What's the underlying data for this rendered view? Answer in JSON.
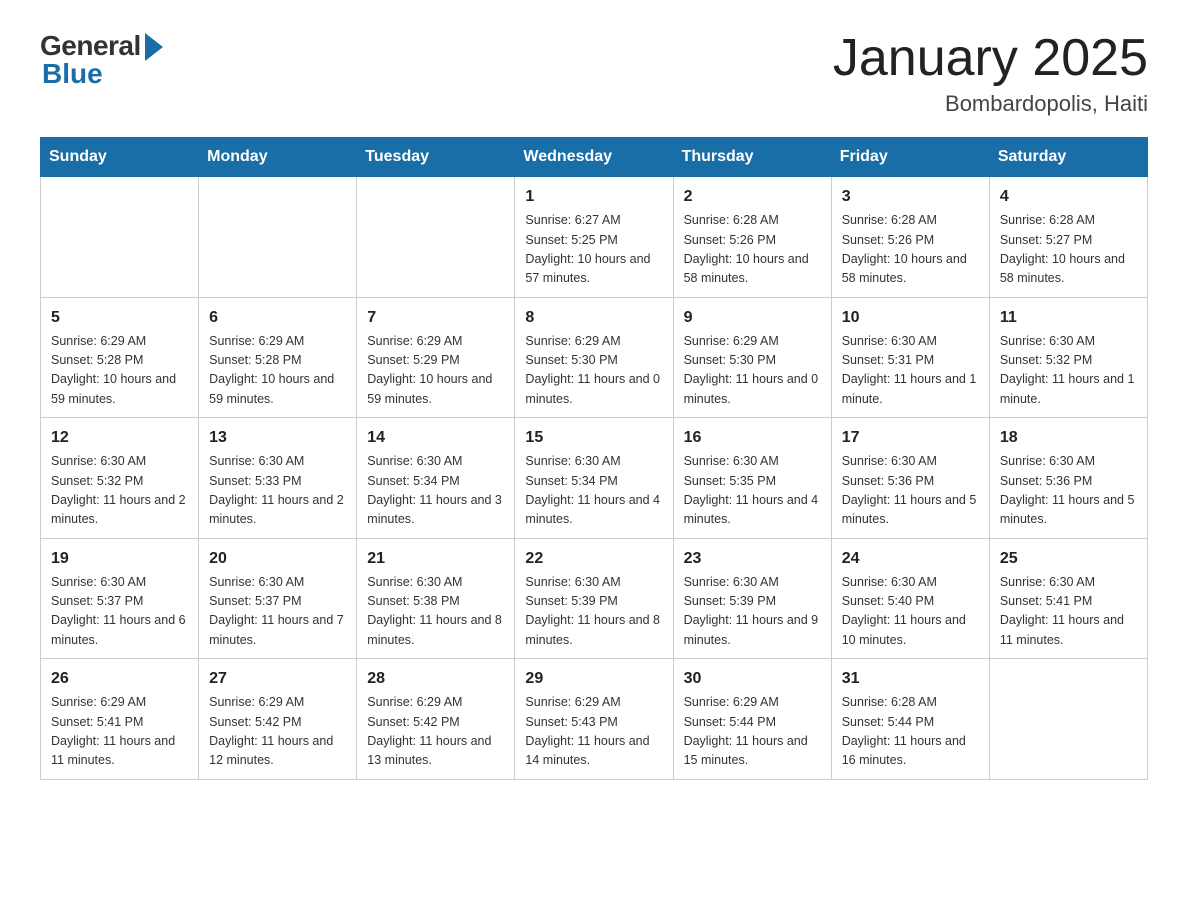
{
  "header": {
    "logo": {
      "general": "General",
      "blue": "Blue"
    },
    "title": "January 2025",
    "location": "Bombardopolis, Haiti"
  },
  "days_of_week": [
    "Sunday",
    "Monday",
    "Tuesday",
    "Wednesday",
    "Thursday",
    "Friday",
    "Saturday"
  ],
  "weeks": [
    {
      "days": [
        {
          "number": "",
          "info": ""
        },
        {
          "number": "",
          "info": ""
        },
        {
          "number": "",
          "info": ""
        },
        {
          "number": "1",
          "info": "Sunrise: 6:27 AM\nSunset: 5:25 PM\nDaylight: 10 hours and 57 minutes."
        },
        {
          "number": "2",
          "info": "Sunrise: 6:28 AM\nSunset: 5:26 PM\nDaylight: 10 hours and 58 minutes."
        },
        {
          "number": "3",
          "info": "Sunrise: 6:28 AM\nSunset: 5:26 PM\nDaylight: 10 hours and 58 minutes."
        },
        {
          "number": "4",
          "info": "Sunrise: 6:28 AM\nSunset: 5:27 PM\nDaylight: 10 hours and 58 minutes."
        }
      ]
    },
    {
      "days": [
        {
          "number": "5",
          "info": "Sunrise: 6:29 AM\nSunset: 5:28 PM\nDaylight: 10 hours and 59 minutes."
        },
        {
          "number": "6",
          "info": "Sunrise: 6:29 AM\nSunset: 5:28 PM\nDaylight: 10 hours and 59 minutes."
        },
        {
          "number": "7",
          "info": "Sunrise: 6:29 AM\nSunset: 5:29 PM\nDaylight: 10 hours and 59 minutes."
        },
        {
          "number": "8",
          "info": "Sunrise: 6:29 AM\nSunset: 5:30 PM\nDaylight: 11 hours and 0 minutes."
        },
        {
          "number": "9",
          "info": "Sunrise: 6:29 AM\nSunset: 5:30 PM\nDaylight: 11 hours and 0 minutes."
        },
        {
          "number": "10",
          "info": "Sunrise: 6:30 AM\nSunset: 5:31 PM\nDaylight: 11 hours and 1 minute."
        },
        {
          "number": "11",
          "info": "Sunrise: 6:30 AM\nSunset: 5:32 PM\nDaylight: 11 hours and 1 minute."
        }
      ]
    },
    {
      "days": [
        {
          "number": "12",
          "info": "Sunrise: 6:30 AM\nSunset: 5:32 PM\nDaylight: 11 hours and 2 minutes."
        },
        {
          "number": "13",
          "info": "Sunrise: 6:30 AM\nSunset: 5:33 PM\nDaylight: 11 hours and 2 minutes."
        },
        {
          "number": "14",
          "info": "Sunrise: 6:30 AM\nSunset: 5:34 PM\nDaylight: 11 hours and 3 minutes."
        },
        {
          "number": "15",
          "info": "Sunrise: 6:30 AM\nSunset: 5:34 PM\nDaylight: 11 hours and 4 minutes."
        },
        {
          "number": "16",
          "info": "Sunrise: 6:30 AM\nSunset: 5:35 PM\nDaylight: 11 hours and 4 minutes."
        },
        {
          "number": "17",
          "info": "Sunrise: 6:30 AM\nSunset: 5:36 PM\nDaylight: 11 hours and 5 minutes."
        },
        {
          "number": "18",
          "info": "Sunrise: 6:30 AM\nSunset: 5:36 PM\nDaylight: 11 hours and 5 minutes."
        }
      ]
    },
    {
      "days": [
        {
          "number": "19",
          "info": "Sunrise: 6:30 AM\nSunset: 5:37 PM\nDaylight: 11 hours and 6 minutes."
        },
        {
          "number": "20",
          "info": "Sunrise: 6:30 AM\nSunset: 5:37 PM\nDaylight: 11 hours and 7 minutes."
        },
        {
          "number": "21",
          "info": "Sunrise: 6:30 AM\nSunset: 5:38 PM\nDaylight: 11 hours and 8 minutes."
        },
        {
          "number": "22",
          "info": "Sunrise: 6:30 AM\nSunset: 5:39 PM\nDaylight: 11 hours and 8 minutes."
        },
        {
          "number": "23",
          "info": "Sunrise: 6:30 AM\nSunset: 5:39 PM\nDaylight: 11 hours and 9 minutes."
        },
        {
          "number": "24",
          "info": "Sunrise: 6:30 AM\nSunset: 5:40 PM\nDaylight: 11 hours and 10 minutes."
        },
        {
          "number": "25",
          "info": "Sunrise: 6:30 AM\nSunset: 5:41 PM\nDaylight: 11 hours and 11 minutes."
        }
      ]
    },
    {
      "days": [
        {
          "number": "26",
          "info": "Sunrise: 6:29 AM\nSunset: 5:41 PM\nDaylight: 11 hours and 11 minutes."
        },
        {
          "number": "27",
          "info": "Sunrise: 6:29 AM\nSunset: 5:42 PM\nDaylight: 11 hours and 12 minutes."
        },
        {
          "number": "28",
          "info": "Sunrise: 6:29 AM\nSunset: 5:42 PM\nDaylight: 11 hours and 13 minutes."
        },
        {
          "number": "29",
          "info": "Sunrise: 6:29 AM\nSunset: 5:43 PM\nDaylight: 11 hours and 14 minutes."
        },
        {
          "number": "30",
          "info": "Sunrise: 6:29 AM\nSunset: 5:44 PM\nDaylight: 11 hours and 15 minutes."
        },
        {
          "number": "31",
          "info": "Sunrise: 6:28 AM\nSunset: 5:44 PM\nDaylight: 11 hours and 16 minutes."
        },
        {
          "number": "",
          "info": ""
        }
      ]
    }
  ]
}
